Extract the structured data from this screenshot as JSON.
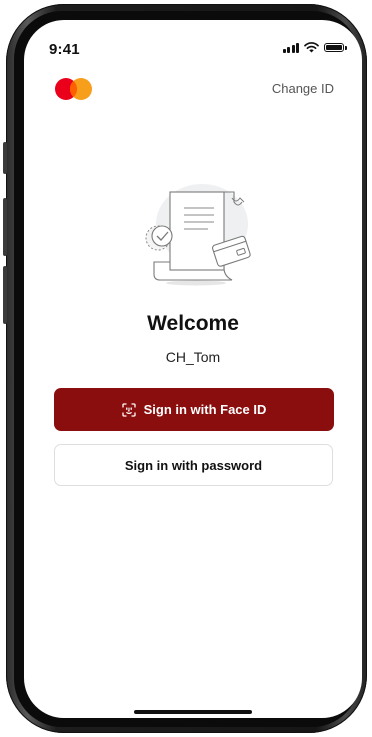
{
  "status_bar": {
    "time": "9:41",
    "icons": [
      "signal-icon",
      "wifi-icon",
      "battery-icon"
    ]
  },
  "header": {
    "logo": "mastercard-logo",
    "change_id_label": "Change ID"
  },
  "illustration": "receipt-card-illustration",
  "welcome": {
    "title": "Welcome",
    "username": "CH_Tom"
  },
  "actions": {
    "face_id_label": "Sign in with Face ID",
    "face_id_icon": "face-id-icon",
    "password_label": "Sign in with password"
  },
  "colors": {
    "primary": "#8b0e0e",
    "logo_red": "#eb001b",
    "logo_orange": "#f79e1b",
    "logo_overlap": "#ff5f00"
  }
}
